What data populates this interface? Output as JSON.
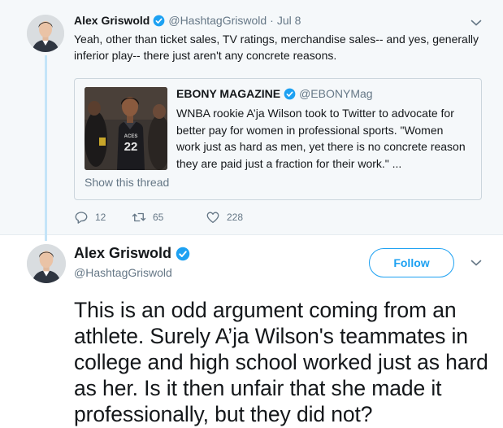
{
  "parent_tweet": {
    "author_name": "Alex Griswold",
    "handle": "@HashtagGriswold",
    "separator": "·",
    "date": "Jul 8",
    "text": "Yeah, other than ticket sales, TV ratings, merchandise sales-- and yes, generally inferior play-- there just aren't any concrete reasons.",
    "quoted": {
      "author_name": "EBONY MAGAZINE",
      "handle": "@EBONYMag",
      "text": "WNBA rookie A’ja Wilson took to Twitter to advocate for better pay for women in professional sports. \"Women work just as hard as men, yet there is no concrete reason they are paid just a fraction for their work.\" ...",
      "image_jersey_text": "ACES",
      "image_jersey_number": "22",
      "show_thread": "Show this thread"
    },
    "actions": {
      "replies": "12",
      "retweets": "65",
      "likes": "228"
    }
  },
  "main_tweet": {
    "author_name": "Alex Griswold",
    "handle": "@HashtagGriswold",
    "follow_label": "Follow",
    "text": "This is an odd argument coming from an athlete. Surely A’ja Wilson's teammates in college and high school worked just as hard as her. Is it then unfair that she made it professionally, but they did not?"
  },
  "colors": {
    "accent": "#1da1f2",
    "secondary_text": "#657786",
    "thread_line": "#c4e4f8",
    "parent_background": "#f5f8fa"
  },
  "icons": {
    "verified": "verified-badge-icon",
    "reply": "reply-icon",
    "retweet": "retweet-icon",
    "like": "heart-icon",
    "menu": "chevron-down-icon"
  }
}
